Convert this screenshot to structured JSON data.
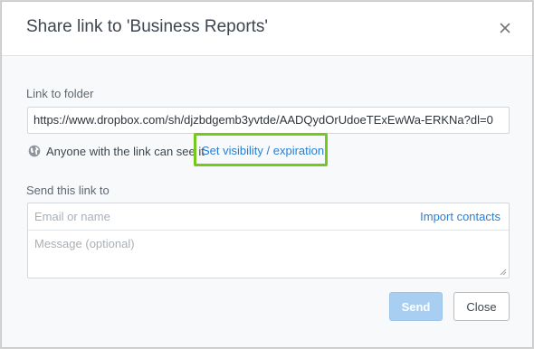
{
  "dialog": {
    "title": "Share link to 'Business Reports'",
    "close_icon": "close-icon"
  },
  "link_section": {
    "label": "Link to folder",
    "url": "https://www.dropbox.com/sh/djzbdgemb3yvtde/AADQydOrUdoeTExEwWa-ERKNa?dl=0",
    "visibility_text": "Anyone with the link can see it",
    "visibility_icon": "globe-icon",
    "visibility_link": "Set visibility / expiration",
    "highlight_color": "#74c91c"
  },
  "send_section": {
    "label": "Send this link to",
    "email_placeholder": "Email or name",
    "import_contacts": "Import contacts",
    "message_placeholder": "Message (optional)"
  },
  "buttons": {
    "send": "Send",
    "close": "Close"
  },
  "colors": {
    "link_blue": "#2a7fd4",
    "send_disabled": "#a8cff2"
  }
}
